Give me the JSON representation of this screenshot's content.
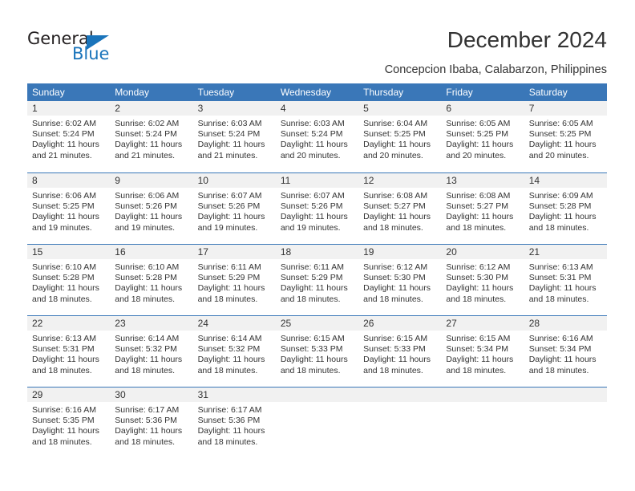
{
  "brand": {
    "name_part1": "General",
    "name_part2": "Blue",
    "triangle_color": "#1a74bb"
  },
  "header": {
    "title": "December 2024",
    "subtitle": "Concepcion Ibaba, Calabarzon, Philippines"
  },
  "calendar": {
    "header_color": "#3a77b8",
    "day_band_color": "#f1f1f1",
    "weekdays": [
      "Sunday",
      "Monday",
      "Tuesday",
      "Wednesday",
      "Thursday",
      "Friday",
      "Saturday"
    ],
    "weeks": [
      [
        {
          "day": "1",
          "sunrise": "Sunrise: 6:02 AM",
          "sunset": "Sunset: 5:24 PM",
          "daylight_line1": "Daylight: 11 hours",
          "daylight_line2": "and 21 minutes."
        },
        {
          "day": "2",
          "sunrise": "Sunrise: 6:02 AM",
          "sunset": "Sunset: 5:24 PM",
          "daylight_line1": "Daylight: 11 hours",
          "daylight_line2": "and 21 minutes."
        },
        {
          "day": "3",
          "sunrise": "Sunrise: 6:03 AM",
          "sunset": "Sunset: 5:24 PM",
          "daylight_line1": "Daylight: 11 hours",
          "daylight_line2": "and 21 minutes."
        },
        {
          "day": "4",
          "sunrise": "Sunrise: 6:03 AM",
          "sunset": "Sunset: 5:24 PM",
          "daylight_line1": "Daylight: 11 hours",
          "daylight_line2": "and 20 minutes."
        },
        {
          "day": "5",
          "sunrise": "Sunrise: 6:04 AM",
          "sunset": "Sunset: 5:25 PM",
          "daylight_line1": "Daylight: 11 hours",
          "daylight_line2": "and 20 minutes."
        },
        {
          "day": "6",
          "sunrise": "Sunrise: 6:05 AM",
          "sunset": "Sunset: 5:25 PM",
          "daylight_line1": "Daylight: 11 hours",
          "daylight_line2": "and 20 minutes."
        },
        {
          "day": "7",
          "sunrise": "Sunrise: 6:05 AM",
          "sunset": "Sunset: 5:25 PM",
          "daylight_line1": "Daylight: 11 hours",
          "daylight_line2": "and 20 minutes."
        }
      ],
      [
        {
          "day": "8",
          "sunrise": "Sunrise: 6:06 AM",
          "sunset": "Sunset: 5:25 PM",
          "daylight_line1": "Daylight: 11 hours",
          "daylight_line2": "and 19 minutes."
        },
        {
          "day": "9",
          "sunrise": "Sunrise: 6:06 AM",
          "sunset": "Sunset: 5:26 PM",
          "daylight_line1": "Daylight: 11 hours",
          "daylight_line2": "and 19 minutes."
        },
        {
          "day": "10",
          "sunrise": "Sunrise: 6:07 AM",
          "sunset": "Sunset: 5:26 PM",
          "daylight_line1": "Daylight: 11 hours",
          "daylight_line2": "and 19 minutes."
        },
        {
          "day": "11",
          "sunrise": "Sunrise: 6:07 AM",
          "sunset": "Sunset: 5:26 PM",
          "daylight_line1": "Daylight: 11 hours",
          "daylight_line2": "and 19 minutes."
        },
        {
          "day": "12",
          "sunrise": "Sunrise: 6:08 AM",
          "sunset": "Sunset: 5:27 PM",
          "daylight_line1": "Daylight: 11 hours",
          "daylight_line2": "and 18 minutes."
        },
        {
          "day": "13",
          "sunrise": "Sunrise: 6:08 AM",
          "sunset": "Sunset: 5:27 PM",
          "daylight_line1": "Daylight: 11 hours",
          "daylight_line2": "and 18 minutes."
        },
        {
          "day": "14",
          "sunrise": "Sunrise: 6:09 AM",
          "sunset": "Sunset: 5:28 PM",
          "daylight_line1": "Daylight: 11 hours",
          "daylight_line2": "and 18 minutes."
        }
      ],
      [
        {
          "day": "15",
          "sunrise": "Sunrise: 6:10 AM",
          "sunset": "Sunset: 5:28 PM",
          "daylight_line1": "Daylight: 11 hours",
          "daylight_line2": "and 18 minutes."
        },
        {
          "day": "16",
          "sunrise": "Sunrise: 6:10 AM",
          "sunset": "Sunset: 5:28 PM",
          "daylight_line1": "Daylight: 11 hours",
          "daylight_line2": "and 18 minutes."
        },
        {
          "day": "17",
          "sunrise": "Sunrise: 6:11 AM",
          "sunset": "Sunset: 5:29 PM",
          "daylight_line1": "Daylight: 11 hours",
          "daylight_line2": "and 18 minutes."
        },
        {
          "day": "18",
          "sunrise": "Sunrise: 6:11 AM",
          "sunset": "Sunset: 5:29 PM",
          "daylight_line1": "Daylight: 11 hours",
          "daylight_line2": "and 18 minutes."
        },
        {
          "day": "19",
          "sunrise": "Sunrise: 6:12 AM",
          "sunset": "Sunset: 5:30 PM",
          "daylight_line1": "Daylight: 11 hours",
          "daylight_line2": "and 18 minutes."
        },
        {
          "day": "20",
          "sunrise": "Sunrise: 6:12 AM",
          "sunset": "Sunset: 5:30 PM",
          "daylight_line1": "Daylight: 11 hours",
          "daylight_line2": "and 18 minutes."
        },
        {
          "day": "21",
          "sunrise": "Sunrise: 6:13 AM",
          "sunset": "Sunset: 5:31 PM",
          "daylight_line1": "Daylight: 11 hours",
          "daylight_line2": "and 18 minutes."
        }
      ],
      [
        {
          "day": "22",
          "sunrise": "Sunrise: 6:13 AM",
          "sunset": "Sunset: 5:31 PM",
          "daylight_line1": "Daylight: 11 hours",
          "daylight_line2": "and 18 minutes."
        },
        {
          "day": "23",
          "sunrise": "Sunrise: 6:14 AM",
          "sunset": "Sunset: 5:32 PM",
          "daylight_line1": "Daylight: 11 hours",
          "daylight_line2": "and 18 minutes."
        },
        {
          "day": "24",
          "sunrise": "Sunrise: 6:14 AM",
          "sunset": "Sunset: 5:32 PM",
          "daylight_line1": "Daylight: 11 hours",
          "daylight_line2": "and 18 minutes."
        },
        {
          "day": "25",
          "sunrise": "Sunrise: 6:15 AM",
          "sunset": "Sunset: 5:33 PM",
          "daylight_line1": "Daylight: 11 hours",
          "daylight_line2": "and 18 minutes."
        },
        {
          "day": "26",
          "sunrise": "Sunrise: 6:15 AM",
          "sunset": "Sunset: 5:33 PM",
          "daylight_line1": "Daylight: 11 hours",
          "daylight_line2": "and 18 minutes."
        },
        {
          "day": "27",
          "sunrise": "Sunrise: 6:15 AM",
          "sunset": "Sunset: 5:34 PM",
          "daylight_line1": "Daylight: 11 hours",
          "daylight_line2": "and 18 minutes."
        },
        {
          "day": "28",
          "sunrise": "Sunrise: 6:16 AM",
          "sunset": "Sunset: 5:34 PM",
          "daylight_line1": "Daylight: 11 hours",
          "daylight_line2": "and 18 minutes."
        }
      ],
      [
        {
          "day": "29",
          "sunrise": "Sunrise: 6:16 AM",
          "sunset": "Sunset: 5:35 PM",
          "daylight_line1": "Daylight: 11 hours",
          "daylight_line2": "and 18 minutes."
        },
        {
          "day": "30",
          "sunrise": "Sunrise: 6:17 AM",
          "sunset": "Sunset: 5:36 PM",
          "daylight_line1": "Daylight: 11 hours",
          "daylight_line2": "and 18 minutes."
        },
        {
          "day": "31",
          "sunrise": "Sunrise: 6:17 AM",
          "sunset": "Sunset: 5:36 PM",
          "daylight_line1": "Daylight: 11 hours",
          "daylight_line2": "and 18 minutes."
        },
        {
          "day": "",
          "sunrise": "",
          "sunset": "",
          "daylight_line1": "",
          "daylight_line2": ""
        },
        {
          "day": "",
          "sunrise": "",
          "sunset": "",
          "daylight_line1": "",
          "daylight_line2": ""
        },
        {
          "day": "",
          "sunrise": "",
          "sunset": "",
          "daylight_line1": "",
          "daylight_line2": ""
        },
        {
          "day": "",
          "sunrise": "",
          "sunset": "",
          "daylight_line1": "",
          "daylight_line2": ""
        }
      ]
    ]
  }
}
